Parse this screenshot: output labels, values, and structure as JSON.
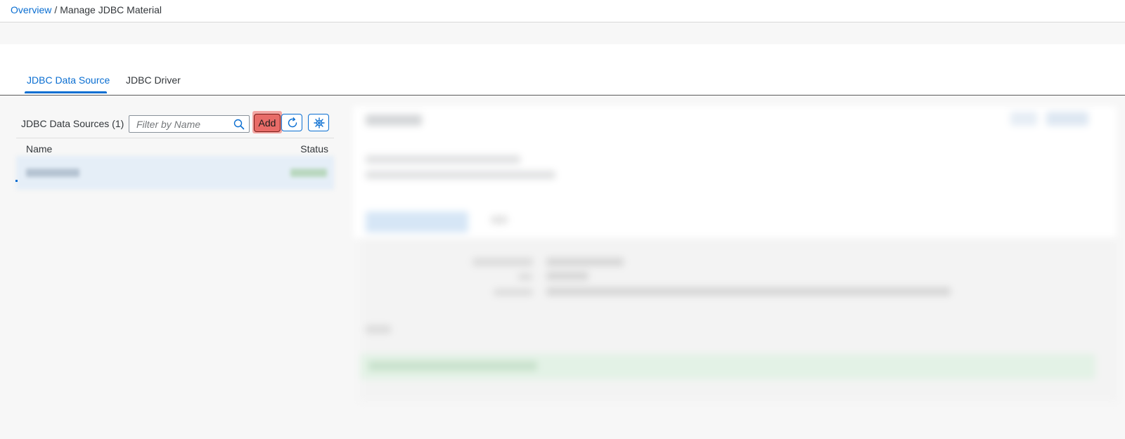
{
  "breadcrumb": {
    "overview": "Overview",
    "separator": "/",
    "current": "Manage JDBC Material"
  },
  "tabs": [
    {
      "label": "JDBC Data Source",
      "active": true
    },
    {
      "label": "JDBC Driver",
      "active": false
    }
  ],
  "data_sources": {
    "title": "JDBC Data Sources (1)",
    "search_placeholder": "Filter by Name",
    "add_label": "Add",
    "columns": {
      "name": "Name",
      "status": "Status"
    }
  },
  "icons": {
    "search": "search-icon",
    "refresh": "refresh-icon",
    "settings": "settings-icon"
  },
  "colors": {
    "accent": "#0a6ed1",
    "add_highlight": "#e86c68",
    "text": "#32363a"
  }
}
